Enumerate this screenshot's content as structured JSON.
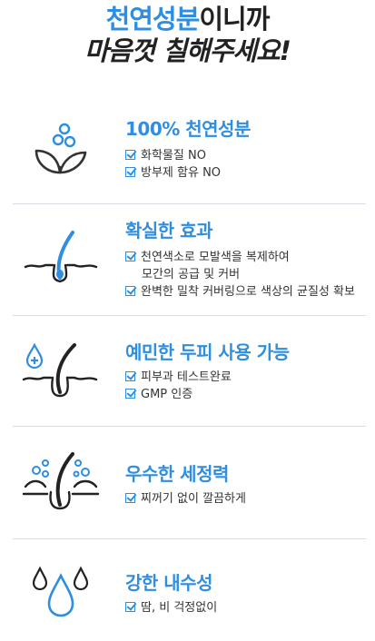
{
  "header": {
    "line1_highlight": "천연성분",
    "line1_rest": "이니까",
    "line2": "마음껏 칠해주세요!"
  },
  "sections": [
    {
      "icon": "plant-sprout-icon",
      "title": "100% 천연성분",
      "items": [
        "화학물질 NO",
        "방부제 함유 NO"
      ]
    },
    {
      "icon": "hair-follicle-icon",
      "title": "확실한 효과",
      "items": [
        "천연색소로 모발색을 복제하여",
        "모간의 공급 및 커버",
        "완벽한 밀착 커버링으로 색상의 균질성 확보"
      ]
    },
    {
      "icon": "sensitive-scalp-icon",
      "title": "예민한 두피 사용 가능",
      "items": [
        "피부과 테스트완료",
        "GMP 인증"
      ]
    },
    {
      "icon": "cleansing-bubbles-icon",
      "title": "우수한 세정력",
      "items": [
        "찌꺼기 없이 깔끔하게"
      ]
    },
    {
      "icon": "water-drops-icon",
      "title": "강한 내수성",
      "items": [
        "땀, 비 걱정없이"
      ]
    }
  ],
  "colors": {
    "accent": "#2f8ee0",
    "text": "#333333",
    "divider": "#d8dde3"
  }
}
